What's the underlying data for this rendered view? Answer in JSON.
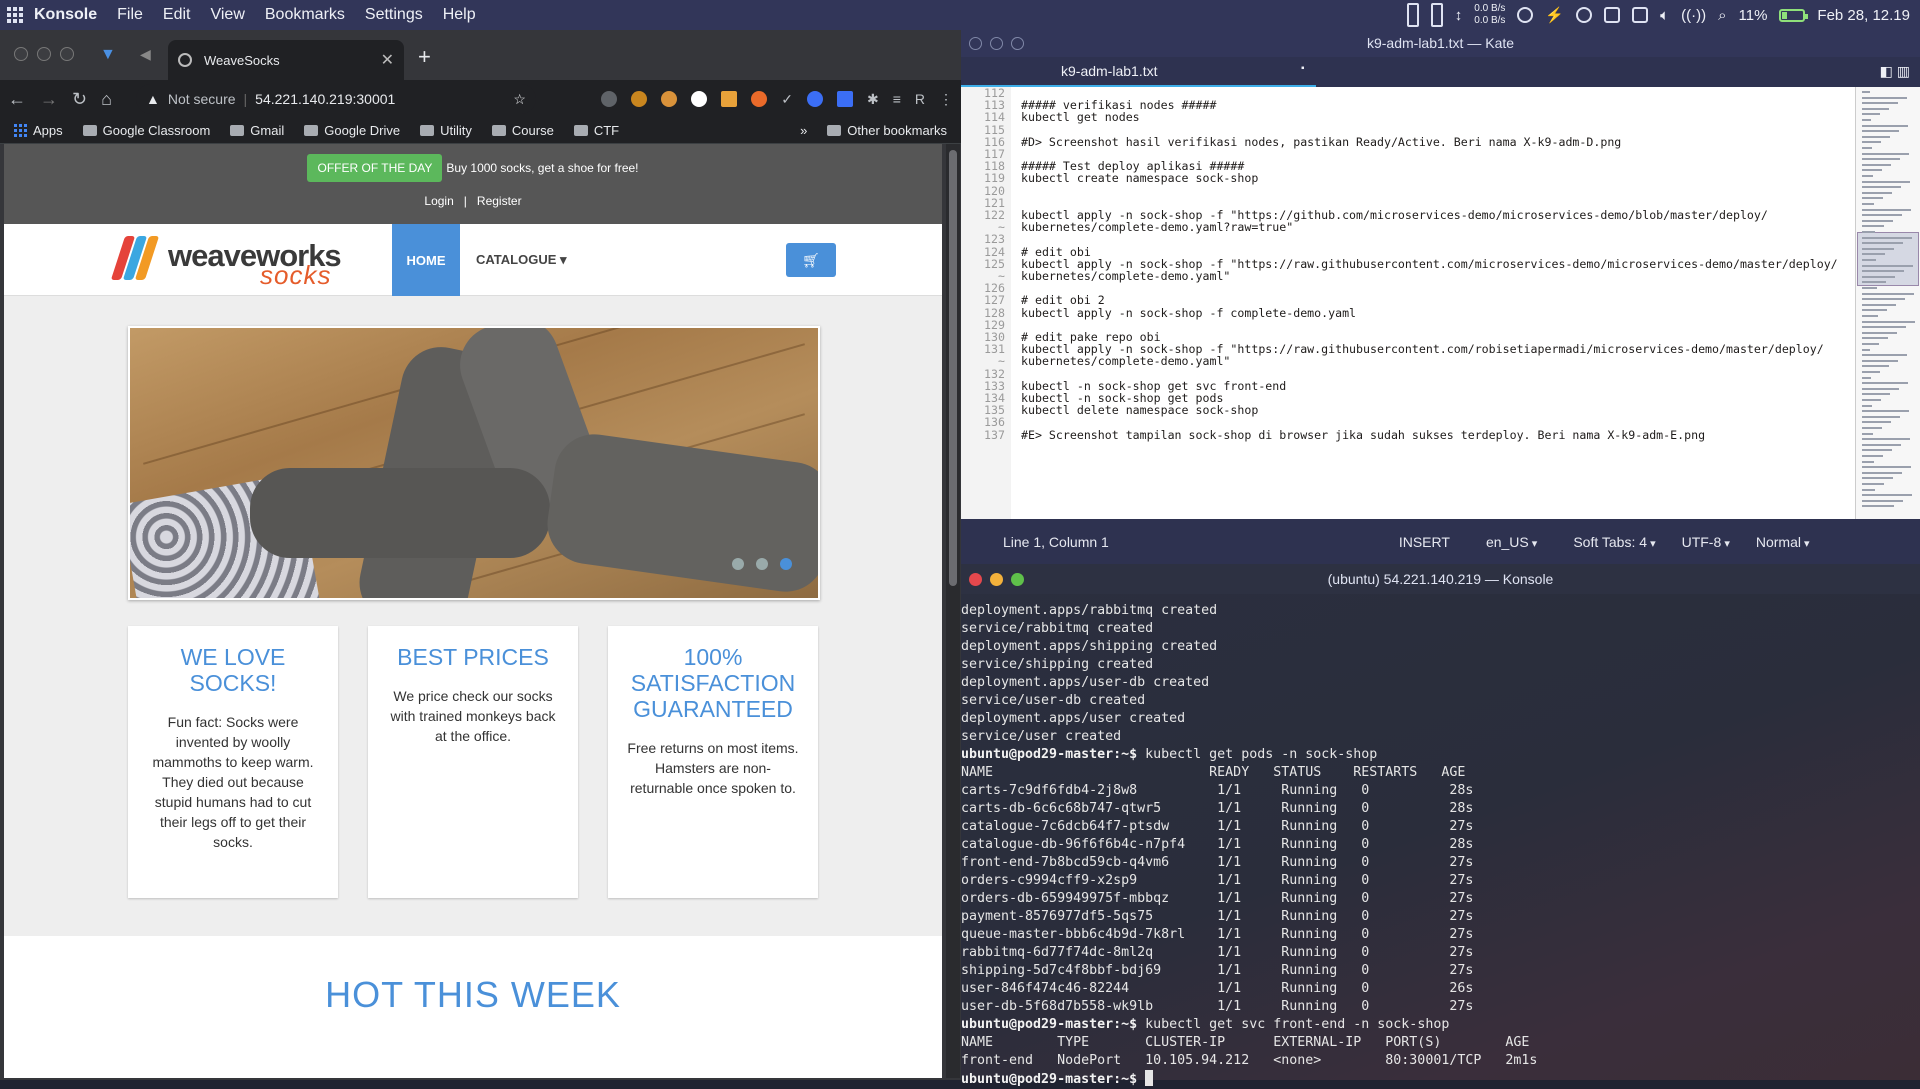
{
  "panel": {
    "app": "Konsole",
    "menu": [
      "File",
      "Edit",
      "View",
      "Bookmarks",
      "Settings",
      "Help"
    ],
    "net_up": "0.0 B/s",
    "net_down": "0.0 B/s",
    "cpu": "11%",
    "datetime": "Feb 28, 12.19"
  },
  "browser": {
    "tab_title": "WeaveSocks",
    "url_warning": "Not secure",
    "url": "54.221.140.219:30001",
    "profile": "R",
    "bookmarks": [
      "Apps",
      "Google Classroom",
      "Gmail",
      "Google Drive",
      "Utility",
      "Course",
      "CTF"
    ],
    "other_bookmarks": "Other bookmarks",
    "bookmarks_overflow": "»"
  },
  "site": {
    "offer_badge": "OFFER OF THE DAY",
    "offer_text": "Buy 1000 socks, get a shoe for free!",
    "login": "Login",
    "sep": "|",
    "register": "Register",
    "logo_word1": "weaveworks",
    "logo_word2": "socks",
    "nav_home": "HOME",
    "nav_catalogue": "CATALOGUE ▾",
    "cards": [
      {
        "title": "WE LOVE SOCKS!",
        "body": "Fun fact: Socks were invented by woolly mammoths to keep warm. They died out because stupid humans had to cut their legs off to get their socks."
      },
      {
        "title": "BEST PRICES",
        "body": "We price check our socks with trained monkeys back at the office."
      },
      {
        "title": "100% SATISFACTION GUARANTEED",
        "body": "Free returns on most items. Hamsters are non-returnable once spoken to."
      }
    ],
    "hot_title": "HOT THIS WEEK"
  },
  "kate": {
    "title": "k9-adm-lab1.txt — Kate",
    "tab": "k9-adm-lab1.txt",
    "line_numbers": [
      "112",
      "113",
      "114",
      "115",
      "116",
      "117",
      "118",
      "119",
      "120",
      "121",
      "122",
      "",
      "123",
      "124",
      "125",
      "",
      "126",
      "127",
      "128",
      "129",
      "130",
      "131",
      "",
      "132",
      "133",
      "134",
      "135",
      "136",
      "137"
    ],
    "code_lines": [
      "",
      "##### verifikasi nodes #####",
      "kubectl get nodes",
      "",
      "#D> Screenshot hasil verifikasi nodes, pastikan Ready/Active. Beri nama X-k9-adm-D.png",
      "",
      "##### Test deploy aplikasi #####",
      "kubectl create namespace sock-shop",
      "",
      "",
      "kubectl apply -n sock-shop -f \"https://github.com/microservices-demo/microservices-demo/blob/master/deploy/",
      "kubernetes/complete-demo.yaml?raw=true\"",
      "",
      "# edit obi",
      "kubectl apply -n sock-shop -f \"https://raw.githubusercontent.com/microservices-demo/microservices-demo/master/deploy/",
      "kubernetes/complete-demo.yaml\"",
      "",
      "# edit obi 2",
      "kubectl apply -n sock-shop -f complete-demo.yaml",
      "",
      "# edit pake repo obi",
      "kubectl apply -n sock-shop -f \"https://raw.githubusercontent.com/robisetiapermadi/microservices-demo/master/deploy/",
      "kubernetes/complete-demo.yaml\"",
      "",
      "kubectl -n sock-shop get svc front-end",
      "kubectl -n sock-shop get pods",
      "kubectl delete namespace sock-shop",
      "",
      "#E> Screenshot tampilan sock-shop di browser jika sudah sukses terdeploy. Beri nama X-k9-adm-E.png"
    ],
    "status": {
      "position": "Line 1, Column 1",
      "mode": "INSERT",
      "lang": "en_US",
      "tabs": "Soft Tabs: 4",
      "encoding": "UTF-8",
      "highlight": "Normal"
    }
  },
  "konsole": {
    "title": "(ubuntu) 54.221.140.219 — Konsole",
    "lines_before": [
      "deployment.apps/rabbitmq created",
      "service/rabbitmq created",
      "deployment.apps/shipping created",
      "service/shipping created",
      "deployment.apps/user-db created",
      "service/user-db created",
      "deployment.apps/user created",
      "service/user created"
    ],
    "prompt": "ubuntu@pod29-master:~$",
    "cmd1": " kubectl get pods -n sock-shop",
    "pods_header": "NAME                           READY   STATUS    RESTARTS   AGE",
    "pods": [
      "carts-7c9df6fdb4-2j8w8          1/1     Running   0          28s",
      "carts-db-6c6c68b747-qtwr5       1/1     Running   0          28s",
      "catalogue-7c6dcb64f7-ptsdw      1/1     Running   0          27s",
      "catalogue-db-96f6f6b4c-n7pf4    1/1     Running   0          28s",
      "front-end-7b8bcd59cb-q4vm6      1/1     Running   0          27s",
      "orders-c9994cff9-x2sp9          1/1     Running   0          27s",
      "orders-db-659949975f-mbbqz      1/1     Running   0          27s",
      "payment-8576977df5-5qs75        1/1     Running   0          27s",
      "queue-master-bbb6c4b9d-7k8rl    1/1     Running   0          27s",
      "rabbitmq-6d77f74dc-8ml2q        1/1     Running   0          27s",
      "shipping-5d7c4f8bbf-bdj69       1/1     Running   0          27s",
      "user-846f474c46-82244           1/1     Running   0          26s",
      "user-db-5f68d7b558-wk9lb        1/1     Running   0          27s"
    ],
    "cmd2": " kubectl get svc front-end -n sock-shop",
    "svc_header": "NAME        TYPE       CLUSTER-IP      EXTERNAL-IP   PORT(S)        AGE",
    "svc_row": "front-end   NodePort   10.105.94.212   <none>        80:30001/TCP   2m1s"
  }
}
